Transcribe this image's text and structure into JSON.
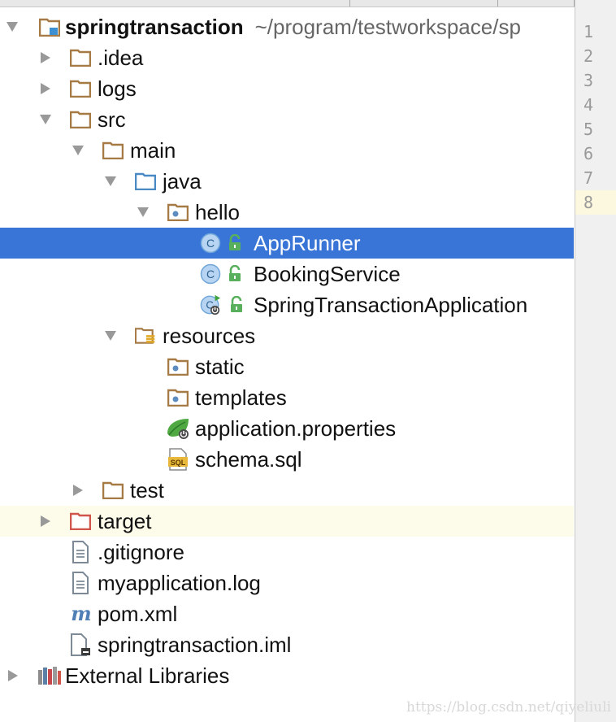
{
  "project_tree": {
    "root": {
      "name": "springtransaction",
      "path": "~/program/testworkspace/sp"
    },
    "items": [
      {
        "name": ".idea"
      },
      {
        "name": "logs"
      },
      {
        "name": "src"
      },
      {
        "name": "main"
      },
      {
        "name": "java"
      },
      {
        "name": "hello"
      },
      {
        "name": "AppRunner"
      },
      {
        "name": "BookingService"
      },
      {
        "name": "SpringTransactionApplication"
      },
      {
        "name": "resources"
      },
      {
        "name": "static"
      },
      {
        "name": "templates"
      },
      {
        "name": "application.properties"
      },
      {
        "name": "schema.sql"
      },
      {
        "name": "test"
      },
      {
        "name": "target"
      },
      {
        "name": ".gitignore"
      },
      {
        "name": "myapplication.log"
      },
      {
        "name": "pom.xml"
      },
      {
        "name": "springtransaction.iml"
      },
      {
        "name": "External Libraries"
      }
    ],
    "selected_item": "AppRunner",
    "highlight_color": "#3875d7"
  },
  "editor_gutter": {
    "line_numbers": [
      "1",
      "2",
      "3",
      "4",
      "5",
      "6",
      "7",
      "8"
    ],
    "current_line": "8"
  },
  "watermark": "https://blog.csdn.net/qiyeliuli",
  "icon_names": [
    "module-folder-icon",
    "folder-icon",
    "source-folder-icon",
    "package-icon",
    "class-icon",
    "spring-boot-class-icon",
    "resources-folder-icon",
    "spring-properties-icon",
    "sql-file-icon",
    "excluded-folder-icon",
    "text-file-icon",
    "maven-icon",
    "iml-file-icon",
    "libraries-icon",
    "lock-icon"
  ]
}
